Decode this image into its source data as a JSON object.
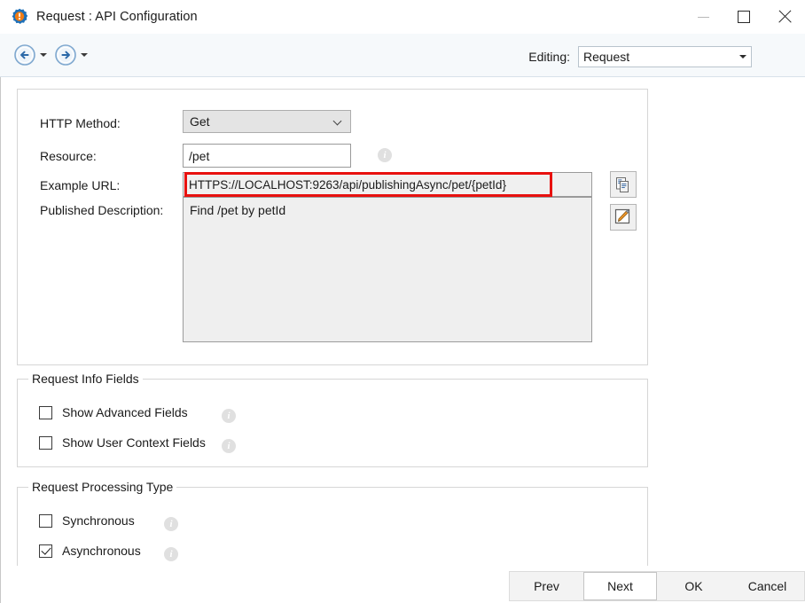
{
  "window": {
    "title": "Request : API Configuration",
    "icon": "gear-icon",
    "controls": {
      "minimize": "minimize-icon",
      "maximize": "maximize-icon",
      "close": "close-icon"
    }
  },
  "toolbar": {
    "back": "back-arrow-icon",
    "back_dropdown": "chevron-down-icon",
    "forward": "forward-arrow-icon",
    "forward_dropdown": "chevron-down-icon",
    "editing_label": "Editing:",
    "editing_value": "Request",
    "editing_dropdown_icon": "chevron-down-icon"
  },
  "form": {
    "http_method": {
      "label": "HTTP Method:",
      "value": "Get"
    },
    "resource": {
      "label": "Resource:",
      "value": "/pet",
      "info_icon": "info-icon"
    },
    "example_url": {
      "label": "Example URL:",
      "value": "HTTPS://LOCALHOST:9263/api/publishingAsync/pet/{petId}",
      "highlight_color": "#e8110f",
      "copy_button_icon": "copy-icon"
    },
    "published_description": {
      "label": "Published Description:",
      "value": "Find /pet by petId",
      "edit_button_icon": "edit-pencil-icon"
    }
  },
  "request_info_fields": {
    "title": "Request Info Fields",
    "items": [
      {
        "label": "Show Advanced Fields",
        "checked": false,
        "info_icon": "info-icon"
      },
      {
        "label": "Show User Context Fields",
        "checked": false,
        "info_icon": "info-icon"
      }
    ]
  },
  "request_processing_type": {
    "title": "Request Processing Type",
    "items": [
      {
        "label": "Synchronous",
        "checked": false,
        "info_icon": "info-icon"
      },
      {
        "label": "Asynchronous",
        "checked": true,
        "info_icon": "info-icon"
      }
    ]
  },
  "footer": {
    "buttons": [
      {
        "label": "Prev",
        "focused": false
      },
      {
        "label": "Next",
        "focused": true
      },
      {
        "label": "OK",
        "focused": false
      },
      {
        "label": "Cancel",
        "focused": false
      }
    ]
  }
}
